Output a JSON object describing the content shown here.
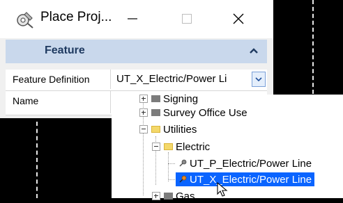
{
  "window": {
    "title": "Place Proj...",
    "app_icon": "gear-tools-icon",
    "controls": [
      "minimize-icon",
      "maximize-icon",
      "close-icon"
    ]
  },
  "feature_section": {
    "title": "Feature",
    "collapse_icon": "chevron-up-icon"
  },
  "properties": {
    "feature_definition": {
      "label": "Feature Definition",
      "value": "UT_X_Electric/Power Li"
    },
    "name": {
      "label": "Name",
      "value": ""
    }
  },
  "tree": {
    "items": [
      {
        "label": "Signing",
        "type": "folder-closed"
      },
      {
        "label": "Survey Office Use",
        "type": "folder-closed"
      },
      {
        "label": "Utilities",
        "type": "folder-open"
      },
      {
        "label": "Electric",
        "type": "folder-open"
      },
      {
        "label": "UT_P_Electric/Power Line",
        "type": "feature"
      },
      {
        "label": "UT_X_Electric/Power Line",
        "type": "feature",
        "selected": true
      },
      {
        "label": "Gas",
        "type": "folder-closed"
      }
    ]
  },
  "colors": {
    "section_header_bg": "#c9d8ec",
    "selection": "#0a64ff",
    "canvas": "#000000"
  }
}
